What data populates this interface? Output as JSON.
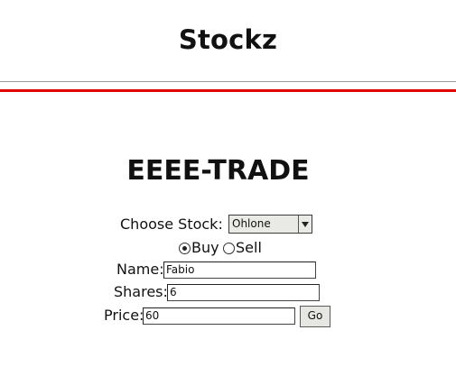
{
  "header": {
    "site_title": "Stockz",
    "divider_color": "#e00000"
  },
  "main": {
    "heading": "EEEE-TRADE"
  },
  "form": {
    "choose_stock_label": "Choose Stock:",
    "stock_selected": "Ohlone",
    "action_options": [
      {
        "label": "Buy",
        "selected": true
      },
      {
        "label": "Sell",
        "selected": false
      }
    ],
    "name_label": "Name:",
    "name_value": "Fabio",
    "shares_label": "Shares:",
    "shares_value": "6",
    "price_label": "Price:",
    "price_value": "60",
    "go_label": "Go"
  },
  "icons": {
    "select_arrow": "chevron-down-icon"
  }
}
